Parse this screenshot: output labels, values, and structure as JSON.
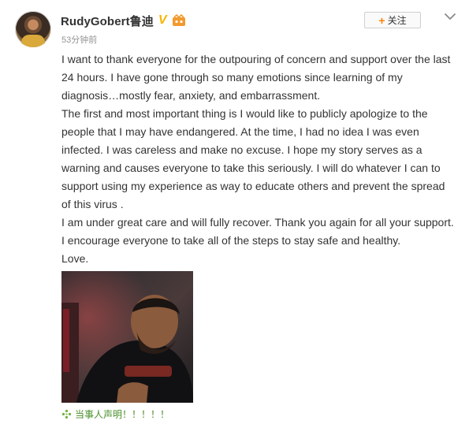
{
  "author": {
    "name": "RudyGobert鲁迪",
    "verified_mark": "V",
    "time_ago": "53分钟前"
  },
  "actions": {
    "follow_label": "关注",
    "follow_plus": "+"
  },
  "post": {
    "paragraphs": [
      "I want to thank everyone for the outpouring of concern and support over the last 24 hours.  I have gone through so many emotions since learning of my diagnosis…mostly fear, anxiety, and embarrassment.",
      "The first and most important thing is I would like to publicly apologize to the people that I may have endangered.  At the time, I had no idea I was even infected.  I was careless and make no excuse.  I hope my story serves as a warning and causes everyone to take this seriously.  I will do whatever I can to support using my experience as way to educate others and prevent the spread of this virus .",
      "I am under great care and will fully recover.  Thank you again for all your support.  I encourage everyone to take all of the steps to stay safe and healthy.",
      "Love."
    ]
  },
  "topic": {
    "label": "当事人声明！！！！！"
  },
  "icons": {
    "avatar": "avatar",
    "verified": "verified-v-icon",
    "vip": "vip-badge-icon",
    "menu": "chevron-down-icon",
    "topic": "sparkle-icon"
  },
  "colors": {
    "verified": "#f7b500",
    "follow_plus": "#ff8200",
    "topic": "#4a8f2a",
    "text": "#333333",
    "muted": "#939393"
  }
}
